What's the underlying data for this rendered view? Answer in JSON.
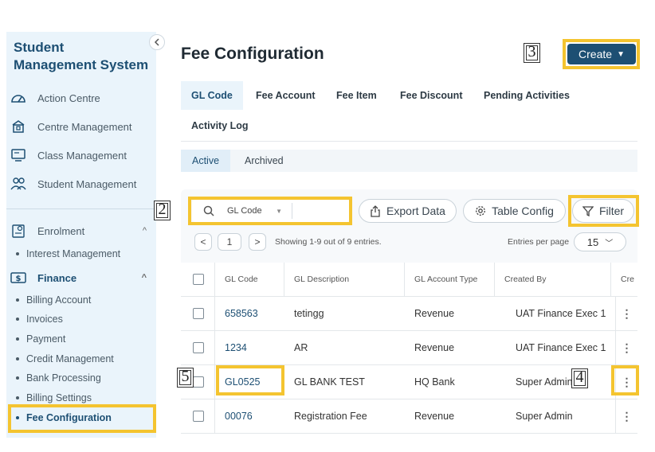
{
  "sidebar": {
    "title": "Student Management System",
    "items": [
      {
        "label": "Action Centre",
        "icon": "gauge-icon"
      },
      {
        "label": "Centre Management",
        "icon": "building-icon"
      },
      {
        "label": "Class Management",
        "icon": "classroom-icon"
      },
      {
        "label": "Student Management",
        "icon": "users-icon"
      }
    ],
    "enrolment": {
      "label": "Enrolment",
      "icon": "enrol-icon",
      "chevron": "^",
      "children": [
        "Interest Management"
      ]
    },
    "finance": {
      "label": "Finance",
      "icon": "dollar-icon",
      "chevron": "^",
      "children": [
        "Billing Account",
        "Invoices",
        "Payment",
        "Credit Management",
        "Bank Processing",
        "Billing Settings",
        "Fee Configuration"
      ],
      "active_child": "Fee Configuration"
    }
  },
  "header": {
    "title": "Fee Configuration",
    "create_label": "Create"
  },
  "tabs": [
    "GL Code",
    "Fee Account",
    "Fee Item",
    "Fee Discount",
    "Pending Activities",
    "Activity Log"
  ],
  "active_tab": "GL Code",
  "subtabs": [
    "Active",
    "Archived"
  ],
  "active_subtab": "Active",
  "search": {
    "field": "GL Code",
    "placeholder": ""
  },
  "toolbar": {
    "export_label": "Export Data",
    "config_label": "Table Config",
    "filter_label": "Filter"
  },
  "pager": {
    "prev": "<",
    "page": "1",
    "next": ">",
    "showing": "Showing 1-9 out of 9 entries.",
    "entries_label": "Entries per page",
    "entries_value": "15"
  },
  "table": {
    "columns": [
      "GL Code",
      "GL Description",
      "GL Account Type",
      "Created By",
      "Cre"
    ],
    "rows": [
      {
        "code": "658563",
        "description": "tetingg",
        "type": "Revenue",
        "created_by": "UAT Finance Exec 1"
      },
      {
        "code": "1234",
        "description": "AR",
        "type": "Revenue",
        "created_by": "UAT Finance Exec 1"
      },
      {
        "code": "GL0525",
        "description": "GL BANK TEST",
        "type": "HQ Bank",
        "created_by": "Super Admin"
      },
      {
        "code": "00076",
        "description": "Registration Fee",
        "type": "Revenue",
        "created_by": "Super Admin"
      }
    ]
  },
  "markers": [
    "2",
    "3",
    "4",
    "5"
  ],
  "colors": {
    "brand": "#1d4f73",
    "highlight": "#f4c430",
    "sidebar_bg": "#eaf4fb"
  }
}
